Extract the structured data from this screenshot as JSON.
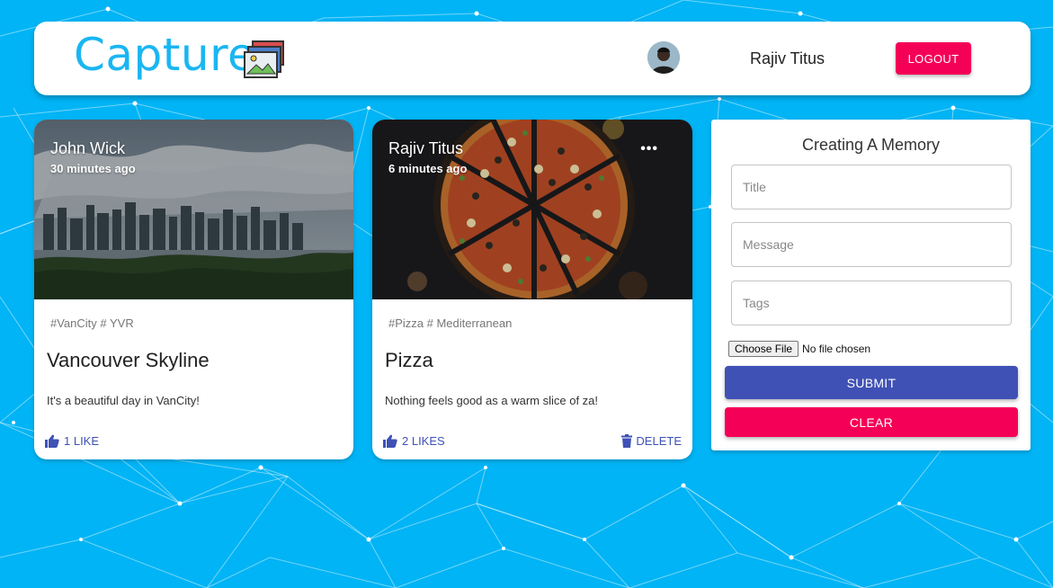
{
  "header": {
    "brand": "Capture",
    "user_name": "Rajiv Titus",
    "logout_label": "LOGOUT"
  },
  "posts": [
    {
      "author": "John Wick",
      "time": "30 minutes ago",
      "tags": "#VanCity # YVR",
      "title": "Vancouver Skyline",
      "message": "It's a beautiful day in VanCity!",
      "likes_label": "1 LIKE",
      "show_more": false,
      "show_delete": false
    },
    {
      "author": "Rajiv Titus",
      "time": "6 minutes ago",
      "tags": "#Pizza # Mediterranean",
      "title": "Pizza",
      "message": "Nothing feels good as a warm slice of za!",
      "likes_label": "2 LIKES",
      "more_label": "•••",
      "delete_label": "DELETE",
      "show_more": true,
      "show_delete": true
    }
  ],
  "form": {
    "heading": "Creating A Memory",
    "title_placeholder": "Title",
    "message_placeholder": "Message",
    "tags_placeholder": "Tags",
    "choose_file_label": "Choose File",
    "file_status": "No file chosen",
    "submit_label": "SUBMIT",
    "clear_label": "CLEAR"
  },
  "colors": {
    "background": "#00b4f5",
    "brand": "#1ab6f2",
    "primary": "#3f51b5",
    "secondary": "#f50057"
  },
  "icons": {
    "brand": "photo-frames-icon",
    "like": "thumb-up-icon",
    "delete": "trash-icon",
    "more": "more-horizontal-icon"
  }
}
